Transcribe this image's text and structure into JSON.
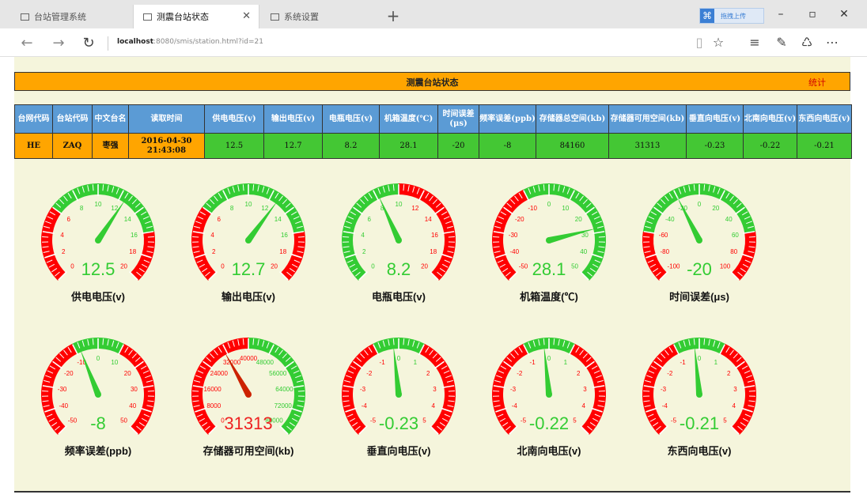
{
  "browser": {
    "tabs": [
      {
        "title": "台站管理系统",
        "active": false
      },
      {
        "title": "测震台站状态",
        "active": true
      },
      {
        "title": "系统设置",
        "active": false
      }
    ],
    "new_tab": "+",
    "share_label": "拖拽上传",
    "url_host": "localhost",
    "url_rest": ":8080/smis/station.html?id=21",
    "window_buttons": [
      "–",
      "▫",
      "✕"
    ]
  },
  "page": {
    "title": "测震台站状态",
    "stat_link": "统计",
    "table": {
      "headers": [
        "台网代码",
        "台站代码",
        "中文台名",
        "读取时间",
        "供电电压(v)",
        "输出电压(v)",
        "电瓶电压(v)",
        "机箱温度(℃)",
        "时间误差(μs)",
        "频率误差(ppb)",
        "存储器总空间(kb)",
        "存储器可用空间(kb)",
        "垂直向电压(v)",
        "北南向电压(v)",
        "东西向电压(v)"
      ],
      "row": [
        "HE",
        "ZAQ",
        "枣强",
        "2016-04-30 21:43:08",
        "12.5",
        "12.7",
        "8.2",
        "28.1",
        "-20",
        "-8",
        "84160",
        "31313",
        "-0.23",
        "-0.22",
        "-0.21"
      ]
    },
    "gauges": [
      {
        "label": "供电电压(v)",
        "value": 12.5,
        "display": "12.5",
        "min": 0,
        "max": 20,
        "ticks": [
          0,
          2,
          4,
          6,
          8,
          10,
          12,
          14,
          16,
          18,
          20
        ],
        "zones": [
          {
            "from": 0,
            "to": 6,
            "color": "#ff0000"
          },
          {
            "from": 6,
            "to": 16,
            "color": "#33cc33"
          },
          {
            "from": 16,
            "to": 20,
            "color": "#ff0000"
          }
        ],
        "value_color": "#33cc33"
      },
      {
        "label": "输出电压(v)",
        "value": 12.7,
        "display": "12.7",
        "min": 0,
        "max": 20,
        "ticks": [
          0,
          2,
          4,
          6,
          8,
          10,
          12,
          14,
          16,
          18,
          20
        ],
        "zones": [
          {
            "from": 0,
            "to": 6,
            "color": "#ff0000"
          },
          {
            "from": 6,
            "to": 16,
            "color": "#33cc33"
          },
          {
            "from": 16,
            "to": 20,
            "color": "#ff0000"
          }
        ],
        "value_color": "#33cc33"
      },
      {
        "label": "电瓶电压(v)",
        "value": 8.2,
        "display": "8.2",
        "min": 0,
        "max": 20,
        "ticks": [
          0,
          2,
          4,
          6,
          8,
          10,
          12,
          14,
          16,
          18,
          20
        ],
        "zones": [
          {
            "from": 0,
            "to": 10,
            "color": "#33cc33"
          },
          {
            "from": 10,
            "to": 20,
            "color": "#ff0000"
          }
        ],
        "value_color": "#33cc33"
      },
      {
        "label": "机箱温度(℃)",
        "value": 28.1,
        "display": "28.1",
        "min": -50,
        "max": 50,
        "ticks": [
          -50,
          -40,
          -30,
          -20,
          -10,
          0,
          10,
          20,
          30,
          40,
          50
        ],
        "zones": [
          {
            "from": -50,
            "to": -10,
            "color": "#ff0000"
          },
          {
            "from": -10,
            "to": 50,
            "color": "#33cc33"
          }
        ],
        "value_color": "#33cc33"
      },
      {
        "label": "时间误差(μs)",
        "value": -20,
        "display": "-20",
        "min": -100,
        "max": 100,
        "ticks": [
          -100,
          -80,
          -60,
          -40,
          -20,
          0,
          20,
          40,
          60,
          80,
          100
        ],
        "zones": [
          {
            "from": -100,
            "to": -60,
            "color": "#ff0000"
          },
          {
            "from": -60,
            "to": 60,
            "color": "#33cc33"
          },
          {
            "from": 60,
            "to": 100,
            "color": "#ff0000"
          }
        ],
        "value_color": "#33cc33"
      },
      {
        "label": "频率误差(ppb)",
        "value": -8,
        "display": "-8",
        "min": -50,
        "max": 50,
        "ticks": [
          -50,
          -40,
          -30,
          -20,
          -10,
          0,
          10,
          20,
          30,
          40,
          50
        ],
        "zones": [
          {
            "from": -50,
            "to": -10,
            "color": "#ff0000"
          },
          {
            "from": -10,
            "to": 10,
            "color": "#33cc33"
          },
          {
            "from": 10,
            "to": 50,
            "color": "#ff0000"
          }
        ],
        "value_color": "#33cc33"
      },
      {
        "label": "存储器可用空间(kb)",
        "value": 31313,
        "display": "31313",
        "min": 0,
        "max": 80000,
        "ticks": [
          0,
          8000,
          16000,
          24000,
          32000,
          40000,
          48000,
          56000,
          64000,
          72000,
          80000
        ],
        "zones": [
          {
            "from": 0,
            "to": 40000,
            "color": "#ff0000"
          },
          {
            "from": 40000,
            "to": 80000,
            "color": "#33cc33"
          }
        ],
        "value_color": "#ee2222",
        "needle_color": "#cc2200"
      },
      {
        "label": "垂直向电压(v)",
        "value": -0.23,
        "display": "-0.23",
        "min": -5,
        "max": 5,
        "ticks": [
          -5,
          -4,
          -3,
          -2,
          -1,
          0,
          1,
          2,
          3,
          4,
          5
        ],
        "zones": [
          {
            "from": -5,
            "to": -1,
            "color": "#ff0000"
          },
          {
            "from": -1,
            "to": 1,
            "color": "#33cc33"
          },
          {
            "from": 1,
            "to": 5,
            "color": "#ff0000"
          }
        ],
        "value_color": "#33cc33"
      },
      {
        "label": "北南向电压(v)",
        "value": -0.22,
        "display": "-0.22",
        "min": -5,
        "max": 5,
        "ticks": [
          -5,
          -4,
          -3,
          -2,
          -1,
          0,
          1,
          2,
          3,
          4,
          5
        ],
        "zones": [
          {
            "from": -5,
            "to": -1,
            "color": "#ff0000"
          },
          {
            "from": -1,
            "to": 1,
            "color": "#33cc33"
          },
          {
            "from": 1,
            "to": 5,
            "color": "#ff0000"
          }
        ],
        "value_color": "#33cc33"
      },
      {
        "label": "东西向电压(v)",
        "value": -0.21,
        "display": "-0.21",
        "min": -5,
        "max": 5,
        "ticks": [
          -5,
          -4,
          -3,
          -2,
          -1,
          0,
          1,
          2,
          3,
          4,
          5
        ],
        "zones": [
          {
            "from": -5,
            "to": -1,
            "color": "#ff0000"
          },
          {
            "from": -1,
            "to": 1,
            "color": "#33cc33"
          },
          {
            "from": 1,
            "to": 5,
            "color": "#ff0000"
          }
        ],
        "value_color": "#33cc33"
      }
    ]
  }
}
